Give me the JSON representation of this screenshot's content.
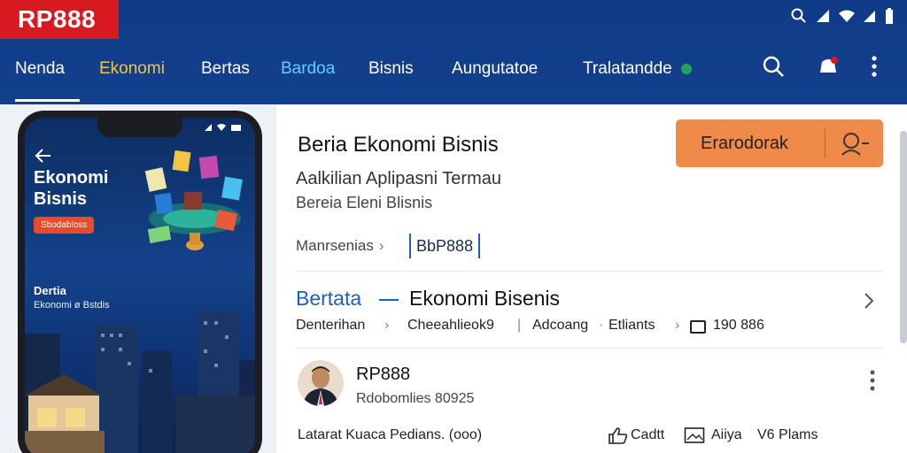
{
  "brand": {
    "logo_text": "RP888",
    "logo_color": "#d71920",
    "header_color": "#0f3b86"
  },
  "nav": {
    "items": [
      {
        "label": "Nenda",
        "active": true
      },
      {
        "label": "Ekonomi",
        "color": "#f4c542"
      },
      {
        "label": "Bertas"
      },
      {
        "label": "Bardoa",
        "color": "#5fd0ff"
      },
      {
        "label": "Bisnis"
      },
      {
        "label": "Aungutatoe"
      },
      {
        "label": "Tralatandde"
      }
    ],
    "icons": [
      "search-icon",
      "notification-icon",
      "more-vert-icon"
    ]
  },
  "phone": {
    "title_line1": "Ekonomi",
    "title_line2": "Bisnis",
    "pill": "Sbodabloss",
    "subtitle1": "Dertia",
    "subtitle2": "Ekonomi ø Bstdis"
  },
  "article": {
    "title": "Beria Ekonomi Bisnis",
    "cta_label": "Erarodorak",
    "cta_color": "#f08a4b",
    "subtitle1": "Aalkilian Aplipasni Termau",
    "subtitle2": "Bereia Eleni Blisnis",
    "breadcrumb": "Manrsenias",
    "brand_tag": "BbP888",
    "section_label": "Bertata",
    "section_name": "Ekonomi Bisenis",
    "meta": [
      "Denterihan",
      "Cheeahlieok9",
      "Adcoang",
      "Etliants",
      "190 886"
    ],
    "author": {
      "name": "RP888",
      "sub": "Rdobomlies 80925"
    },
    "footer": {
      "text": "Latarat Kuaca Pedians. (ooo)",
      "like": "Cadtt",
      "image_label": "Aiiya",
      "views": "V6 Plams"
    },
    "accent": "#1d5fbf"
  }
}
